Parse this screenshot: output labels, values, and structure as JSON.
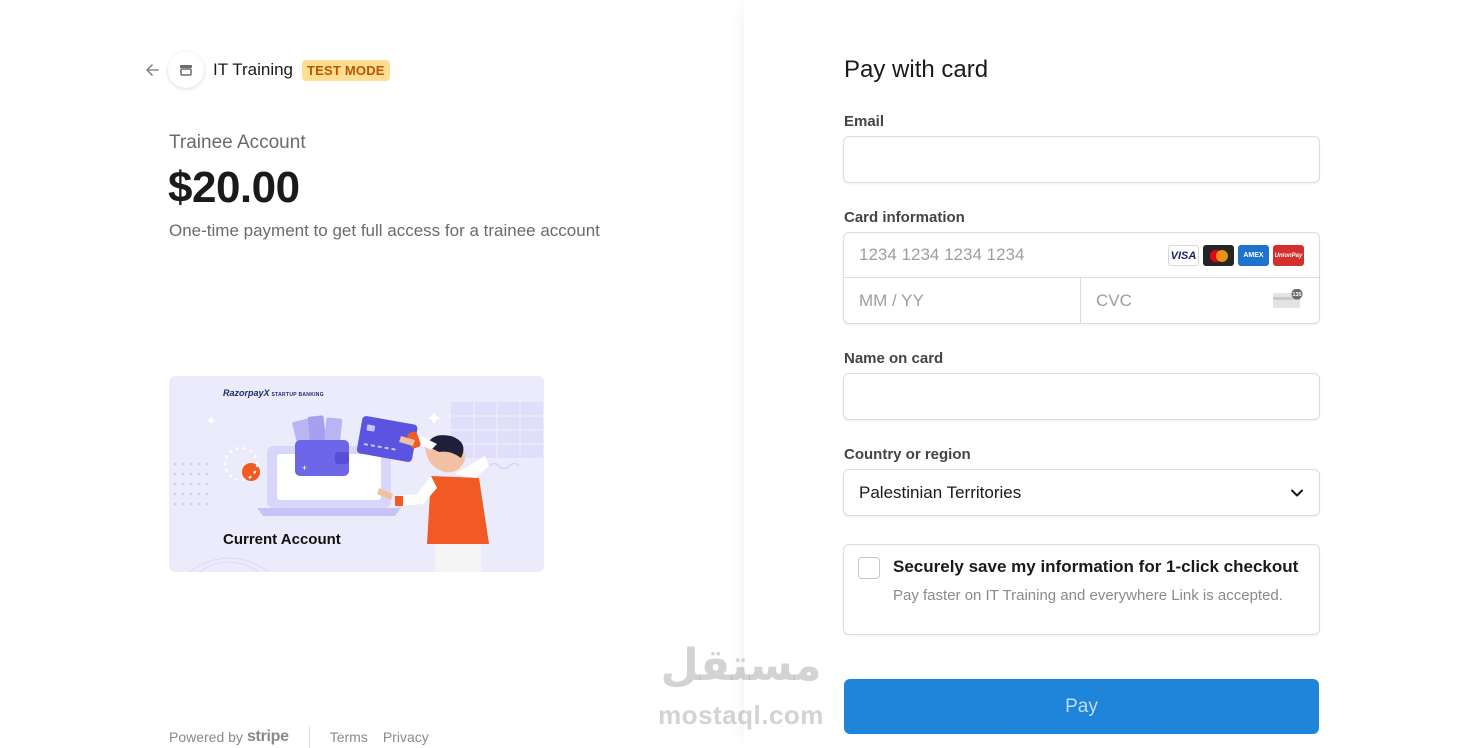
{
  "header": {
    "merchant_name": "IT Training",
    "test_badge": "TEST MODE"
  },
  "product": {
    "name": "Trainee Account",
    "price": "$20.00",
    "description": "One-time payment to get full access for a trainee account",
    "image_brand": "RazorpayX",
    "image_brand_sub": "STARTUP BANKING",
    "image_caption": "Current Account"
  },
  "footer": {
    "powered_by": "Powered by",
    "stripe": "stripe",
    "terms": "Terms",
    "privacy": "Privacy"
  },
  "form": {
    "title": "Pay with card",
    "email_label": "Email",
    "email_value": "",
    "card_label": "Card information",
    "card_number_placeholder": "1234 1234 1234 1234",
    "card_exp_placeholder": "MM / YY",
    "card_cvc_placeholder": "CVC",
    "card_brands": [
      "VISA",
      "mastercard",
      "AMEX",
      "UnionPay"
    ],
    "name_label": "Name on card",
    "name_value": "",
    "country_label": "Country or region",
    "country_value": "Palestinian Territories",
    "save_title": "Securely save my information for 1-click checkout",
    "save_desc": "Pay faster on IT Training and everywhere Link is accepted.",
    "save_checked": false,
    "pay_label": "Pay"
  },
  "watermark": {
    "arabic": "مستقل",
    "latin": "mostaql.com"
  },
  "colors": {
    "accent": "#0074d4",
    "badge_bg": "#ffde92",
    "badge_text": "#bb5504"
  }
}
